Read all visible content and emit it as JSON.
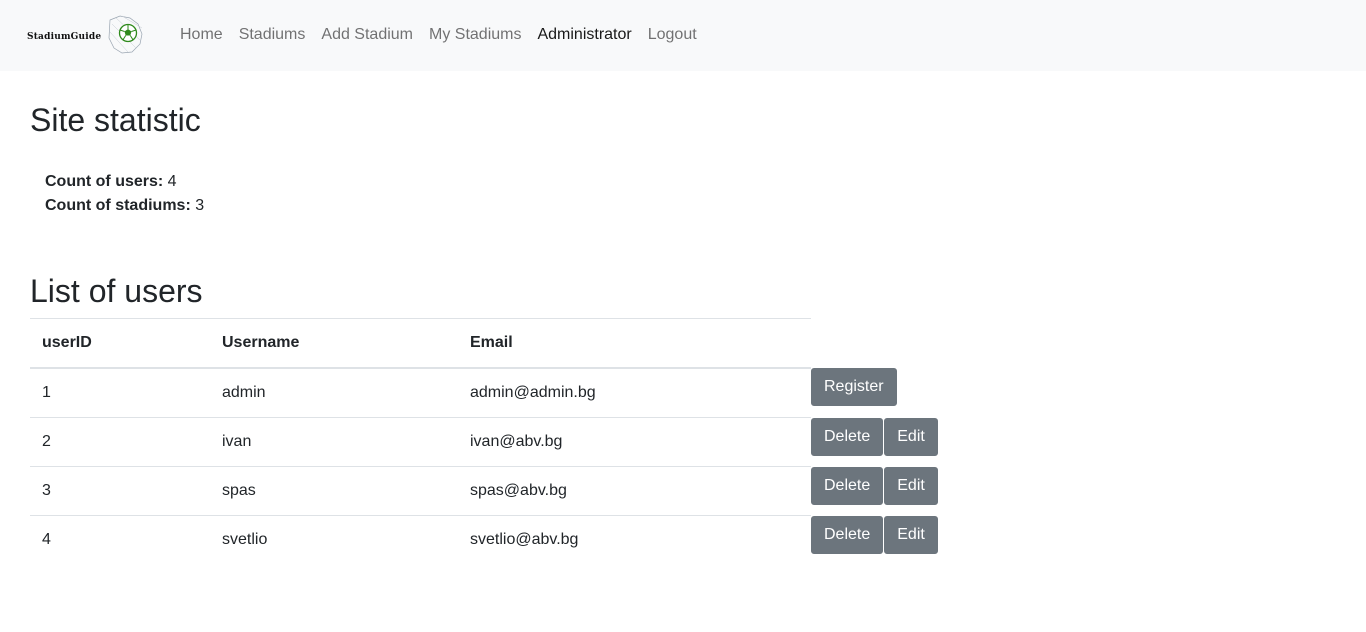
{
  "brand": {
    "name_part1": "StadiumGuide",
    "logo_icon": "soccer-ball-icon"
  },
  "nav": {
    "items": [
      {
        "label": "Home"
      },
      {
        "label": "Stadiums"
      },
      {
        "label": "Add Stadium"
      },
      {
        "label": "My Stadiums"
      },
      {
        "label": "Administrator"
      },
      {
        "label": "Logout"
      }
    ],
    "active": "Administrator"
  },
  "stats": {
    "title": "Site statistic",
    "users_label": "Count of users:",
    "users_value": "4",
    "stadiums_label": "Count of stadiums:",
    "stadiums_value": "3"
  },
  "users": {
    "title": "List of users",
    "columns": [
      "userID",
      "Username",
      "Email"
    ],
    "rows": [
      {
        "id": "1",
        "username": "admin",
        "email": "admin@admin.bg",
        "actions": [
          "Register"
        ]
      },
      {
        "id": "2",
        "username": "ivan",
        "email": "ivan@abv.bg",
        "actions": [
          "Delete",
          "Edit"
        ]
      },
      {
        "id": "3",
        "username": "spas",
        "email": "spas@abv.bg",
        "actions": [
          "Delete",
          "Edit"
        ]
      },
      {
        "id": "4",
        "username": "svetlio",
        "email": "svetlio@abv.bg",
        "actions": [
          "Delete",
          "Edit"
        ]
      }
    ]
  },
  "colors": {
    "navbar_bg": "#f8f9fa",
    "button_bg": "#6c757d",
    "brand_green": "#2f8a1c"
  }
}
